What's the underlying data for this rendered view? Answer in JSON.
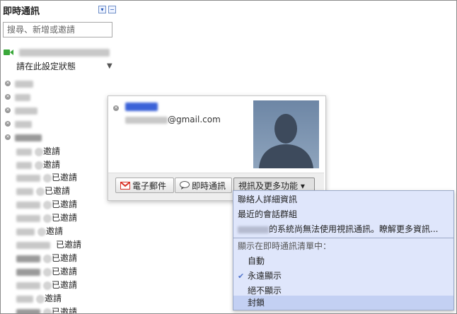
{
  "header": {
    "title": "即時通訊"
  },
  "search": {
    "placeholder": "搜尋、新增或邀請"
  },
  "self": {
    "status_text": "請在此設定狀態"
  },
  "contacts": {
    "invite_label": "邀請",
    "invited_label": "已邀請"
  },
  "card": {
    "email_suffix": "@gmail.com",
    "buttons": {
      "email": "電子郵件",
      "chat": "即時通訊",
      "more": "視訊及更多功能 ▾"
    }
  },
  "menu": {
    "contact_details": "聯絡人詳細資訊",
    "recent_conversations": "最近的會話群組",
    "video_unavailable": "的系統尚無法使用視訊通訊。瞭解更多資訊...",
    "show_in_list_header": "顯示在即時通訊清單中：",
    "auto": "自動",
    "always_show": "永遠顯示",
    "never_show": "絕不顯示",
    "block": "封鎖"
  },
  "colors": {
    "accent": "#1a4fb5",
    "menu_bg": "#dfe6fb",
    "menu_highlight": "#c3d0f3",
    "video_green": "#3aa83a",
    "gmail_red": "#d93025"
  },
  "icons": {
    "minimize": "dropdown-arrow-icon",
    "collapse": "minus-icon",
    "video": "video-camera-icon",
    "status_dropdown": "chevron-down-icon",
    "remove": "x-circle-icon",
    "email": "gmail-icon",
    "chat": "speech-bubble-icon",
    "check": "checkmark-icon"
  }
}
